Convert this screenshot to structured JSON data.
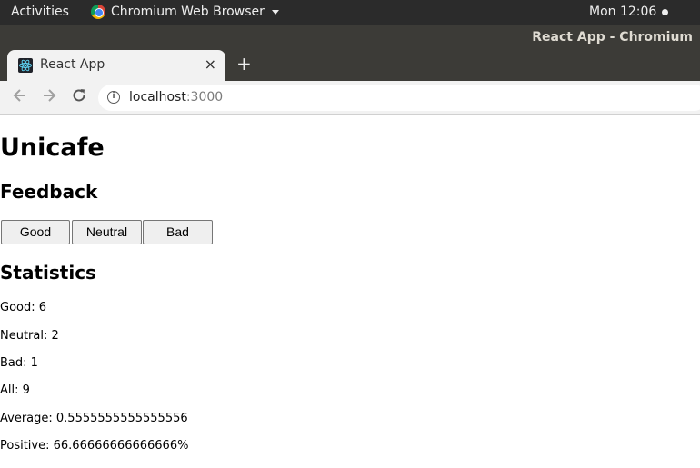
{
  "system_bar": {
    "activities_label": "Activities",
    "app_menu_label": "Chromium Web Browser",
    "clock": "Mon 12:06"
  },
  "window": {
    "title": "React App - Chromium"
  },
  "browser": {
    "tab": {
      "title": "React App",
      "close_glyph": "×"
    },
    "new_tab_glyph": "+",
    "address": {
      "host": "localhost",
      "port": ":3000"
    },
    "icons": {
      "back": "back-arrow-icon",
      "forward": "forward-arrow-icon",
      "reload": "reload-icon",
      "site_info": "info-icon"
    }
  },
  "page": {
    "title": "Unicafe",
    "feedback_heading": "Feedback",
    "buttons": {
      "good": "Good",
      "neutral": "Neutral",
      "bad": "Bad"
    },
    "statistics_heading": "Statistics",
    "stats": {
      "good": "Good: 6",
      "neutral": "Neutral: 2",
      "bad": "Bad: 1",
      "all": "All: 9",
      "average": "Average: 0.5555555555555556",
      "positive": "Positive: 66.66666666666666%"
    }
  }
}
